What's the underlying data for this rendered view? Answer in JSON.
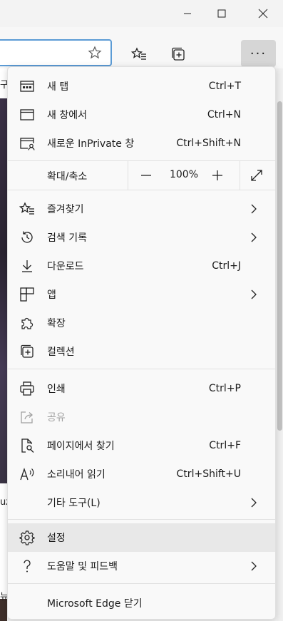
{
  "window": {
    "controls": [
      "minimize-icon",
      "maximize-icon",
      "close-icon"
    ]
  },
  "toolbar": {
    "more_label": "···"
  },
  "edge_text": {
    "t1": "구",
    "t2": "uz",
    "t3": "뉴"
  },
  "menu": {
    "new_tab": {
      "label": "새 탭",
      "shortcut": "Ctrl+T"
    },
    "new_window": {
      "label": "새 창에서",
      "shortcut": "Ctrl+N"
    },
    "inprivate": {
      "label": "새로운 InPrivate 창",
      "shortcut": "Ctrl+Shift+N"
    },
    "zoom": {
      "label": "확대/축소",
      "minus": "—",
      "value": "100%",
      "plus": "+"
    },
    "favorites": {
      "label": "즐겨찾기"
    },
    "history": {
      "label": "검색 기록"
    },
    "downloads": {
      "label": "다운로드",
      "shortcut": "Ctrl+J"
    },
    "apps": {
      "label": "앱"
    },
    "extensions": {
      "label": "확장"
    },
    "collections": {
      "label": "컬렉션"
    },
    "print": {
      "label": "인쇄",
      "shortcut": "Ctrl+P"
    },
    "share": {
      "label": "공유"
    },
    "find": {
      "label": "페이지에서 찾기",
      "shortcut": "Ctrl+F"
    },
    "read_aloud": {
      "label": "소리내어 읽기",
      "shortcut": "Ctrl+Shift+U"
    },
    "more_tools": {
      "label": "기타 도구(L)"
    },
    "settings": {
      "label": "설정"
    },
    "help": {
      "label": "도움말 및 피드백"
    },
    "close_edge": {
      "label": "Microsoft Edge 닫기"
    }
  },
  "colors": {
    "menu_bg": "#f9f9f9",
    "hover_bg": "#e8e8e8",
    "address_border": "#5b9bd5",
    "disabled_text": "#a0a0a0"
  }
}
